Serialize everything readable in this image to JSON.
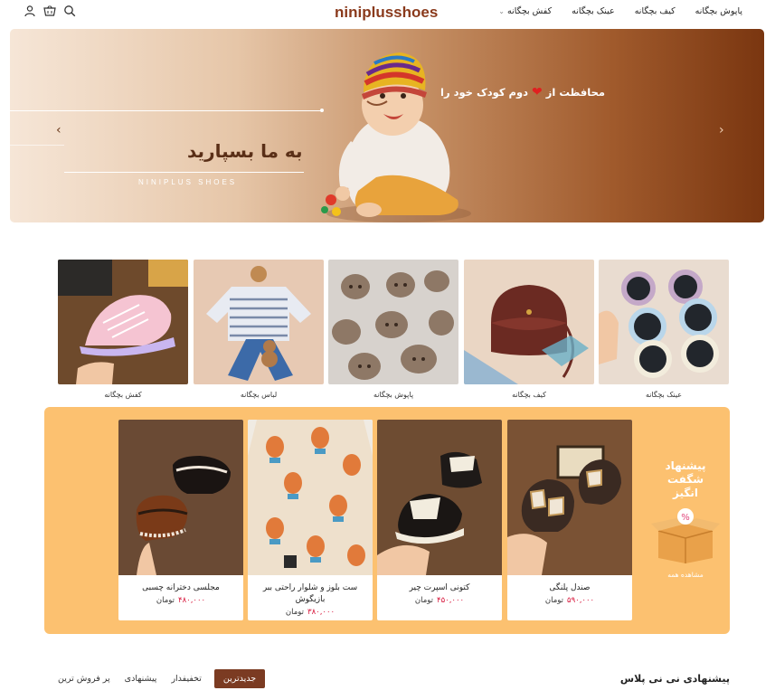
{
  "header": {
    "logo": "niniplusshoes",
    "nav": [
      {
        "label": "کفش بچگانه",
        "has_dropdown": true
      },
      {
        "label": "عینک بچگانه",
        "has_dropdown": false
      },
      {
        "label": "کیف بچگانه",
        "has_dropdown": false
      },
      {
        "label": "پاپوش بچگانه",
        "has_dropdown": false
      }
    ],
    "icons": [
      "user-icon",
      "cart-icon",
      "search-icon"
    ]
  },
  "hero": {
    "title": "به ما بسپارید",
    "subtitle": "NINIPLUS SHOES",
    "tagline_start": "محافظت از",
    "tagline_end": "دوم کودک خود را",
    "prev_arrow": "‹",
    "next_arrow": "›"
  },
  "categories": [
    {
      "label": "کفش بچگانه"
    },
    {
      "label": "لباس بچگانه"
    },
    {
      "label": "پاپوش بچگانه"
    },
    {
      "label": "کیف بچگانه"
    },
    {
      "label": "عینک بچگانه"
    }
  ],
  "offers": {
    "title_line1": "پیشنهاد",
    "title_line2": "شگفت",
    "title_line3": "انگیز",
    "see_all": "مشاهده همه",
    "products": [
      {
        "name": "مجلسی دخترانه چسبی",
        "price": "۴۸۰,۰۰۰",
        "currency": "تومان"
      },
      {
        "name": "ست بلوز و شلوار راحتی ببر بازیگوش",
        "price": "۳۸۰,۰۰۰",
        "currency": "تومان"
      },
      {
        "name": "کتونی اسپرت چیر",
        "price": "۴۵۰,۰۰۰",
        "currency": "تومان"
      },
      {
        "name": "صندل پلنگی",
        "price": "۵۹۰,۰۰۰",
        "currency": "تومان"
      }
    ]
  },
  "bottom": {
    "title": "پیشنهادی نی نی پلاس",
    "tabs": [
      {
        "label": "جدیدترین",
        "active": true
      },
      {
        "label": "تخفیفدار",
        "active": false
      },
      {
        "label": "پیشنهادی",
        "active": false
      },
      {
        "label": "پر فروش ترین",
        "active": false
      }
    ]
  },
  "colors": {
    "brand": "#8a3a1c",
    "offer_bg": "#fcc170",
    "price": "#d8173c",
    "active_tab": "#7b3b22"
  }
}
